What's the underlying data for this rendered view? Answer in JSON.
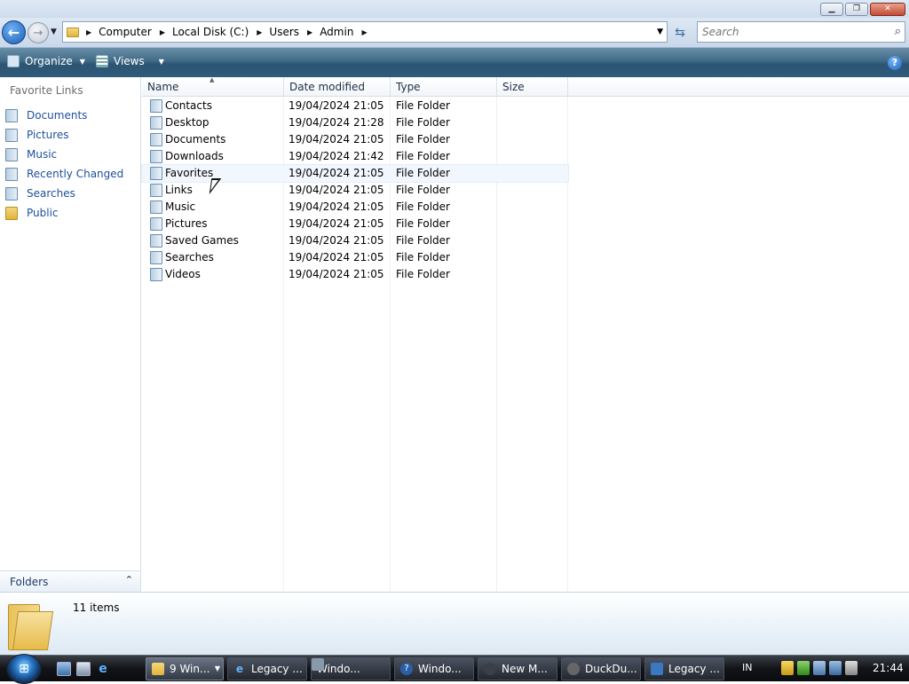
{
  "window": {
    "caption_buttons": {
      "minimize": "▁",
      "maximize": "❐",
      "close": "✕"
    }
  },
  "address": {
    "crumbs": [
      "Computer",
      "Local Disk (C:)",
      "Users",
      "Admin"
    ],
    "search_placeholder": "Search"
  },
  "toolbar": {
    "organize_label": "Organize",
    "views_label": "Views",
    "help_glyph": "?"
  },
  "navigation": {
    "title": "Favorite Links",
    "items": [
      {
        "label": "Documents",
        "icon": "documents-icon"
      },
      {
        "label": "Pictures",
        "icon": "pictures-icon"
      },
      {
        "label": "Music",
        "icon": "music-icon"
      },
      {
        "label": "Recently Changed",
        "icon": "recently-changed-icon"
      },
      {
        "label": "Searches",
        "icon": "searches-icon"
      },
      {
        "label": "Public",
        "icon": "folder-icon"
      }
    ],
    "folders_label": "Folders",
    "folders_chevron": "⌃"
  },
  "columns": {
    "name": "Name",
    "date": "Date modified",
    "type": "Type",
    "size": "Size"
  },
  "files": [
    {
      "name": "Contacts",
      "date": "19/04/2024 21:05",
      "type": "File Folder"
    },
    {
      "name": "Desktop",
      "date": "19/04/2024 21:28",
      "type": "File Folder"
    },
    {
      "name": "Documents",
      "date": "19/04/2024 21:05",
      "type": "File Folder"
    },
    {
      "name": "Downloads",
      "date": "19/04/2024 21:42",
      "type": "File Folder"
    },
    {
      "name": "Favorites",
      "date": "19/04/2024 21:05",
      "type": "File Folder"
    },
    {
      "name": "Links",
      "date": "19/04/2024 21:05",
      "type": "File Folder"
    },
    {
      "name": "Music",
      "date": "19/04/2024 21:05",
      "type": "File Folder"
    },
    {
      "name": "Pictures",
      "date": "19/04/2024 21:05",
      "type": "File Folder"
    },
    {
      "name": "Saved Games",
      "date": "19/04/2024 21:05",
      "type": "File Folder"
    },
    {
      "name": "Searches",
      "date": "19/04/2024 21:05",
      "type": "File Folder"
    },
    {
      "name": "Videos",
      "date": "19/04/2024 21:05",
      "type": "File Folder"
    }
  ],
  "details": {
    "item_count": "11 items"
  },
  "taskbar": {
    "tasks": [
      {
        "label": "9 Win...",
        "icon": "folder",
        "active": true
      },
      {
        "label": "Legacy ...",
        "icon": "ie"
      },
      {
        "label": "Windo...",
        "icon": "win"
      },
      {
        "label": "Windo...",
        "icon": "q"
      },
      {
        "label": "New M...",
        "icon": "nm"
      },
      {
        "label": "DuckDu...",
        "icon": "dk"
      },
      {
        "label": "Legacy ...",
        "icon": "lg"
      }
    ],
    "language": "IN",
    "clock": "21:44"
  }
}
